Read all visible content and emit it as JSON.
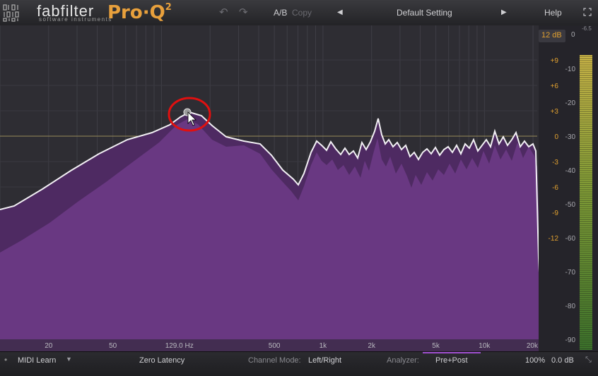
{
  "header": {
    "brand": "fabfilter",
    "brand_sub": "software instruments",
    "product": "Pro·Q",
    "product_version": "2",
    "undo_icon": "undo-icon",
    "redo_icon": "redo-icon",
    "ab_label": "A/B",
    "copy_label": "Copy",
    "preset_prev": "◀",
    "preset_name": "Default Setting",
    "preset_next": "▶",
    "help_label": "Help",
    "fullscreen_icon": "fullscreen-icon"
  },
  "graph": {
    "range_label": "12 dB",
    "zero_label": "0",
    "meter_top_label": "-6.5",
    "eq_scale": [
      "+9",
      "+6",
      "+3",
      "0",
      "-3",
      "-6",
      "-9",
      "-12"
    ],
    "analyzer_scale": [
      "-10",
      "-20",
      "-30",
      "-40",
      "-50",
      "-60",
      "-70",
      "-80",
      "-90"
    ],
    "freq_labels": [
      "20",
      "50",
      "129.0 Hz",
      "500",
      "1k",
      "2k",
      "5k",
      "10k",
      "20k"
    ],
    "band_freq_readout": "129.0 Hz",
    "colors": {
      "background": "#2e2d33",
      "spectrum_fill": "#6b3a84",
      "spectrum_dark": "#4e2a62",
      "eq_curve": "#f2f0f4",
      "zero_line": "#b8a860",
      "scale_text": "#e0a030",
      "highlight_circle": "#e01010"
    }
  },
  "bottom": {
    "midi_learn": "MIDI Learn",
    "latency": "Zero Latency",
    "channel_mode_label": "Channel Mode:",
    "channel_mode_value": "Left/Right",
    "analyzer_label": "Analyzer:",
    "analyzer_value": "Pre+Post",
    "zoom": "100%",
    "output_gain": "0.0 dB"
  }
}
